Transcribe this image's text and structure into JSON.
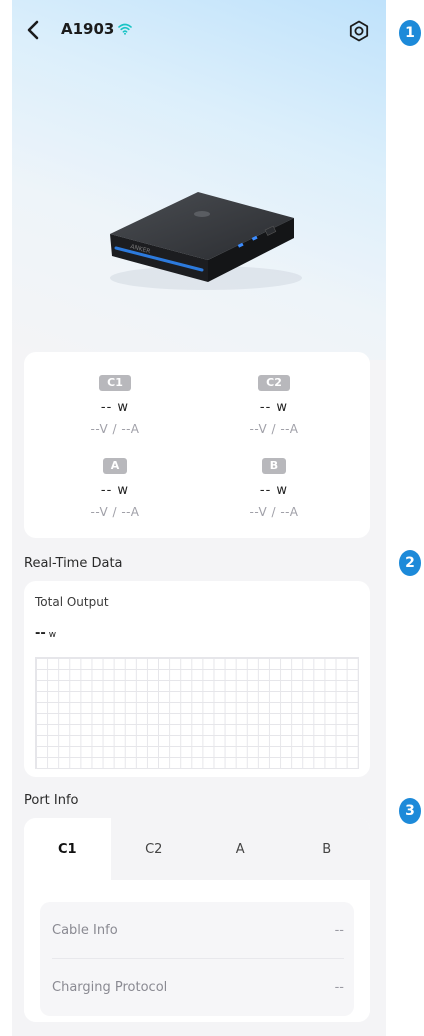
{
  "header": {
    "device_name": "A1903"
  },
  "ports": [
    {
      "label": "C1",
      "watts": "-- w",
      "va": "--V / --A"
    },
    {
      "label": "C2",
      "watts": "-- w",
      "va": "--V / --A"
    },
    {
      "label": "A",
      "watts": "-- w",
      "va": "--V / --A"
    },
    {
      "label": "B",
      "watts": "-- w",
      "va": "--V / --A"
    }
  ],
  "realtime": {
    "section_title": "Real-Time Data",
    "total_label": "Total Output",
    "total_value": "--",
    "total_unit": "w"
  },
  "port_info": {
    "section_title": "Port Info",
    "tabs": [
      "C1",
      "C2",
      "A",
      "B"
    ],
    "active_tab": "C1",
    "rows": [
      {
        "key": "Cable Info",
        "value": "--"
      },
      {
        "key": "Charging Protocol",
        "value": "--"
      }
    ]
  },
  "markers": [
    "1",
    "2",
    "3"
  ],
  "colors": {
    "accent": "#1d8ad9",
    "wifi": "#19c4c4",
    "badge": "#b8b8bc"
  }
}
